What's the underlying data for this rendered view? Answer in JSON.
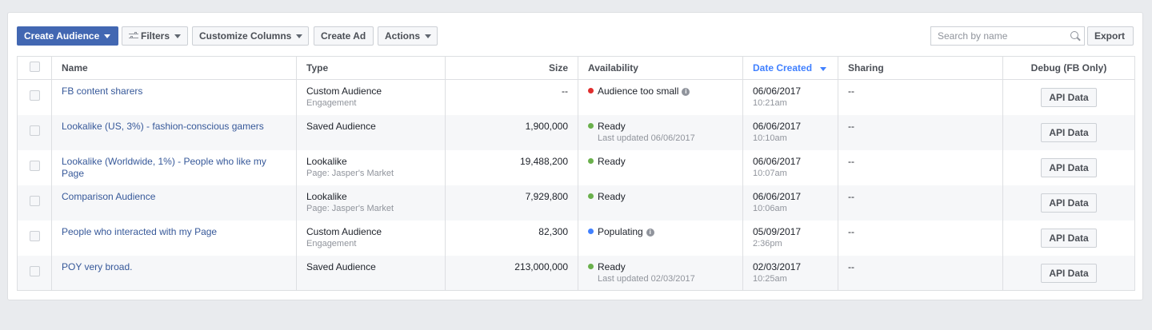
{
  "toolbar": {
    "create_audience": "Create Audience",
    "filters": "Filters",
    "customize_columns": "Customize Columns",
    "create_ad": "Create Ad",
    "actions": "Actions",
    "search_placeholder": "Search by name",
    "export": "Export"
  },
  "columns": {
    "name": "Name",
    "type": "Type",
    "size": "Size",
    "availability": "Availability",
    "date_created": "Date Created",
    "sharing": "Sharing",
    "debug": "Debug (FB Only)"
  },
  "status_colors": {
    "red": "#e02d2d",
    "green": "#6ab04c",
    "blue": "#4080ff"
  },
  "rows": [
    {
      "name_line1": "FB content sharers",
      "name_line2": "",
      "type": "Custom Audience",
      "type_sub": "Engagement",
      "size": "--",
      "status": "Audience too small",
      "status_sub": "",
      "date": "06/06/2017",
      "time": "10:21am",
      "sharing": "--",
      "debug": "API Data"
    },
    {
      "name_line1": "Lookalike (US, 3%) - fashion-conscious gamers",
      "name_line2": "",
      "type": "Saved Audience",
      "type_sub": "",
      "size": "1,900,000",
      "status": "Ready",
      "status_sub": "Last updated 06/06/2017",
      "date": "06/06/2017",
      "time": "10:10am",
      "sharing": "--",
      "debug": "API Data"
    },
    {
      "name_line1": "Lookalike (Worldwide, 1%) - People who like my",
      "name_line2": "Page",
      "type": "Lookalike",
      "type_sub": "Page: Jasper's Market",
      "size": "19,488,200",
      "status": "Ready",
      "status_sub": "",
      "date": "06/06/2017",
      "time": "10:07am",
      "sharing": "--",
      "debug": "API Data"
    },
    {
      "name_line1": "Comparison Audience",
      "name_line2": "",
      "type": "Lookalike",
      "type_sub": "Page: Jasper's Market",
      "size": "7,929,800",
      "status": "Ready",
      "status_sub": "",
      "date": "06/06/2017",
      "time": "10:06am",
      "sharing": "--",
      "debug": "API Data"
    },
    {
      "name_line1": "People who interacted with my Page",
      "name_line2": "",
      "type": "Custom Audience",
      "type_sub": "Engagement",
      "size": "82,300",
      "status": "Populating",
      "status_sub": "",
      "date": "05/09/2017",
      "time": "2:36pm",
      "sharing": "--",
      "debug": "API Data"
    },
    {
      "name_line1": "POY very broad.",
      "name_line2": "",
      "type": "Saved Audience",
      "type_sub": "",
      "size": "213,000,000",
      "status": "Ready",
      "status_sub": "Last updated 02/03/2017",
      "date": "02/03/2017",
      "time": "10:25am",
      "sharing": "--",
      "debug": "API Data"
    }
  ]
}
